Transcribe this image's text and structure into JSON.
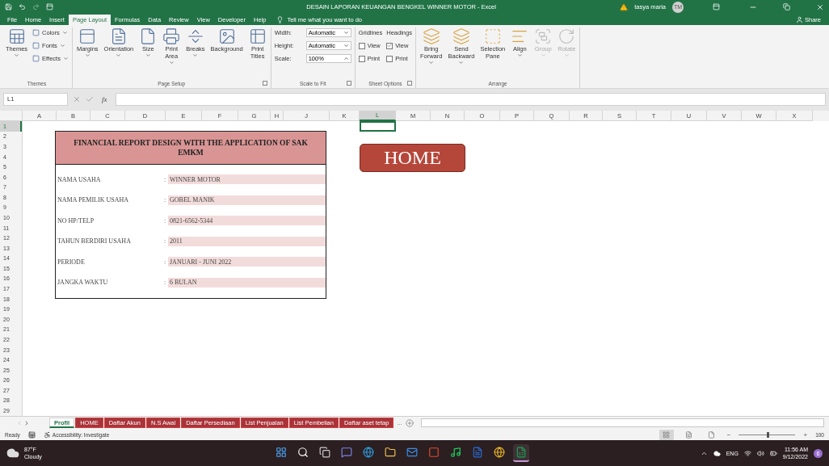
{
  "title_bar": {
    "title": "DESAIN LAPORAN KEUANGAN BENGKEL WINNER MOTOR  -  Excel",
    "user": "tasya maria",
    "avatar": "TM"
  },
  "menu_tabs": [
    {
      "label": "File",
      "selected": false
    },
    {
      "label": "Home",
      "selected": false
    },
    {
      "label": "Insert",
      "selected": false
    },
    {
      "label": "Page Layout",
      "selected": true
    },
    {
      "label": "Formulas",
      "selected": false
    },
    {
      "label": "Data",
      "selected": false
    },
    {
      "label": "Review",
      "selected": false
    },
    {
      "label": "View",
      "selected": false
    },
    {
      "label": "Developer",
      "selected": false
    },
    {
      "label": "Help",
      "selected": false
    }
  ],
  "tell_me": "Tell me what you want to do",
  "share": "Share",
  "ribbon": [
    {
      "label": "Themes",
      "launcher": false,
      "columns": [
        [
          {
            "kind": "large",
            "lines": [
              "Themes"
            ],
            "dropdown": true,
            "disabled": false
          }
        ],
        [
          {
            "kind": "small",
            "label": "Colors",
            "dropdown": true
          },
          {
            "kind": "small",
            "label": "Fonts",
            "dropdown": true
          },
          {
            "kind": "small",
            "label": "Effects",
            "dropdown": true
          }
        ]
      ]
    },
    {
      "label": "Page Setup",
      "launcher": true,
      "columns": [
        [
          {
            "kind": "large",
            "lines": [
              "Margins"
            ],
            "dropdown": true,
            "disabled": false
          }
        ],
        [
          {
            "kind": "large",
            "lines": [
              "Orientation"
            ],
            "dropdown": true,
            "disabled": false
          }
        ],
        [
          {
            "kind": "large",
            "lines": [
              "Size"
            ],
            "dropdown": true,
            "disabled": false
          }
        ],
        [
          {
            "kind": "large",
            "lines": [
              "Print",
              "Area"
            ],
            "dropdown": true,
            "disabled": false
          }
        ],
        [
          {
            "kind": "large",
            "lines": [
              "Breaks"
            ],
            "dropdown": true,
            "disabled": false
          }
        ],
        [
          {
            "kind": "large",
            "lines": [
              "Background"
            ],
            "dropdown": false,
            "disabled": false
          }
        ],
        [
          {
            "kind": "large",
            "lines": [
              "Print",
              "Titles"
            ],
            "dropdown": false,
            "disabled": false
          }
        ]
      ]
    },
    {
      "label": "Scale to Fit",
      "launcher": true,
      "columns": [
        [
          {
            "kind": "select",
            "label": "Width:",
            "value": "Automatic"
          },
          {
            "kind": "select",
            "label": "Height:",
            "value": "Automatic"
          },
          {
            "kind": "spin",
            "label": "Scale:",
            "value": "100%"
          }
        ]
      ]
    },
    {
      "label": "Sheet Options",
      "launcher": true,
      "columns": [
        [
          {
            "kind": "heading",
            "label": "Gridlines"
          },
          {
            "kind": "check",
            "label": "View",
            "checked": false
          },
          {
            "kind": "check",
            "label": "Print",
            "checked": false
          }
        ],
        [
          {
            "kind": "heading",
            "label": "Headings"
          },
          {
            "kind": "check",
            "label": "View",
            "checked": true
          },
          {
            "kind": "check",
            "label": "Print",
            "checked": false
          }
        ]
      ]
    },
    {
      "label": "Arrange",
      "launcher": false,
      "columns": [
        [
          {
            "kind": "large",
            "lines": [
              "Bring",
              "Forward"
            ],
            "dropdown": true,
            "disabled": false
          }
        ],
        [
          {
            "kind": "large",
            "lines": [
              "Send",
              "Backward"
            ],
            "dropdown": true,
            "disabled": false
          }
        ],
        [
          {
            "kind": "large",
            "lines": [
              "Selection",
              "Pane"
            ],
            "dropdown": false,
            "disabled": false
          }
        ],
        [
          {
            "kind": "large",
            "lines": [
              "Align"
            ],
            "dropdown": true,
            "disabled": false
          }
        ],
        [
          {
            "kind": "large",
            "lines": [
              "Group"
            ],
            "dropdown": true,
            "disabled": true
          }
        ],
        [
          {
            "kind": "large",
            "lines": [
              "Rotate"
            ],
            "dropdown": true,
            "disabled": true
          }
        ]
      ]
    }
  ],
  "formula_bar": {
    "name_box": "L1",
    "function_label": "fx"
  },
  "columns": [
    {
      "label": "A",
      "selected": false
    },
    {
      "label": "B",
      "selected": false
    },
    {
      "label": "C",
      "selected": false
    },
    {
      "label": "D",
      "selected": false
    },
    {
      "label": "E",
      "selected": false
    },
    {
      "label": "F",
      "selected": false
    },
    {
      "label": "G",
      "selected": false
    },
    {
      "label": "H",
      "selected": false
    },
    {
      "label": "J",
      "selected": false
    },
    {
      "label": "K",
      "selected": false
    },
    {
      "label": "L",
      "selected": true
    },
    {
      "label": "M",
      "selected": false
    },
    {
      "label": "N",
      "selected": false
    },
    {
      "label": "O",
      "selected": false
    },
    {
      "label": "P",
      "selected": false
    },
    {
      "label": "Q",
      "selected": false
    },
    {
      "label": "R",
      "selected": false
    },
    {
      "label": "S",
      "selected": false
    },
    {
      "label": "T",
      "selected": false
    },
    {
      "label": "U",
      "selected": false
    },
    {
      "label": "V",
      "selected": false
    },
    {
      "label": "W",
      "selected": false
    },
    {
      "label": "X",
      "selected": false
    }
  ],
  "rows": [
    {
      "label": "1",
      "selected": true
    },
    {
      "label": "2",
      "selected": false
    },
    {
      "label": "3",
      "selected": false
    },
    {
      "label": "4",
      "selected": false
    },
    {
      "label": "5",
      "selected": false
    },
    {
      "label": "6",
      "selected": false
    },
    {
      "label": "7",
      "selected": false
    },
    {
      "label": "8",
      "selected": false
    },
    {
      "label": "9",
      "selected": false
    },
    {
      "label": "10",
      "selected": false
    },
    {
      "label": "11",
      "selected": false
    },
    {
      "label": "12",
      "selected": false
    },
    {
      "label": "13",
      "selected": false
    },
    {
      "label": "14",
      "selected": false
    },
    {
      "label": "15",
      "selected": false
    },
    {
      "label": "16",
      "selected": false
    },
    {
      "label": "17",
      "selected": false
    },
    {
      "label": "18",
      "selected": false
    },
    {
      "label": "19",
      "selected": false
    },
    {
      "label": "20",
      "selected": false
    },
    {
      "label": "21",
      "selected": false
    },
    {
      "label": "22",
      "selected": false
    },
    {
      "label": "23",
      "selected": false
    },
    {
      "label": "24",
      "selected": false
    },
    {
      "label": "25",
      "selected": false
    },
    {
      "label": "26",
      "selected": false
    },
    {
      "label": "27",
      "selected": false
    },
    {
      "label": "28",
      "selected": false
    },
    {
      "label": "29",
      "selected": false
    }
  ],
  "profile_table": {
    "title": "FINANCIAL REPORT DESIGN WITH THE APPLICATION OF SAK EMKM",
    "fields": [
      {
        "label": "NAMA USAHA",
        "separator": ":",
        "value": "WINNER MOTOR"
      },
      {
        "label": "NAMA PEMILIK USAHA",
        "separator": ":",
        "value": "GOBEL MANIK"
      },
      {
        "label": "NO HP/TELP",
        "separator": ":",
        "value": "0821-6562-5344"
      },
      {
        "label": "TAHUN BERDIRI USAHA",
        "separator": ":",
        "value": "2011"
      },
      {
        "label": "PERIODE",
        "separator": ":",
        "value": "JANUARI - JUNI 2022"
      },
      {
        "label": "JANGKA WAKTU",
        "separator": ":",
        "value": "6 BULAN"
      }
    ]
  },
  "home_button": "HOME",
  "sheet_tabs": [
    {
      "label": "Profil",
      "selected": true
    },
    {
      "label": "HOME",
      "selected": false
    },
    {
      "label": "Daftar Akun",
      "selected": false
    },
    {
      "label": "N.S Awal",
      "selected": false
    },
    {
      "label": "Daftar Persediaan",
      "selected": false
    },
    {
      "label": "List Penjualan",
      "selected": false
    },
    {
      "label": "List Pembelian",
      "selected": false
    },
    {
      "label": "Daftar aset tetap",
      "selected": false
    }
  ],
  "more_sheets": "...",
  "status_bar": {
    "ready": "Ready",
    "accessibility": "Accessibility: Investigate",
    "views": [
      {
        "selected": true
      },
      {
        "selected": false
      },
      {
        "selected": false
      }
    ],
    "zoom_out": "−",
    "zoom_slider": {
      "level": 0.5
    },
    "zoom_in": "+",
    "zoom": "100"
  },
  "taskbar": {
    "temperature": "87°F",
    "weather": "Cloudy",
    "apps": [
      {
        "active": false
      },
      {
        "active": false
      },
      {
        "active": false
      },
      {
        "active": false
      },
      {
        "active": false
      },
      {
        "active": false
      },
      {
        "active": false
      },
      {
        "active": false
      },
      {
        "active": false
      },
      {
        "active": false
      },
      {
        "active": false
      },
      {
        "active": true
      }
    ],
    "language": "ENG",
    "time": "11:56 AM",
    "date": "9/12/2022",
    "notifications": "6"
  }
}
